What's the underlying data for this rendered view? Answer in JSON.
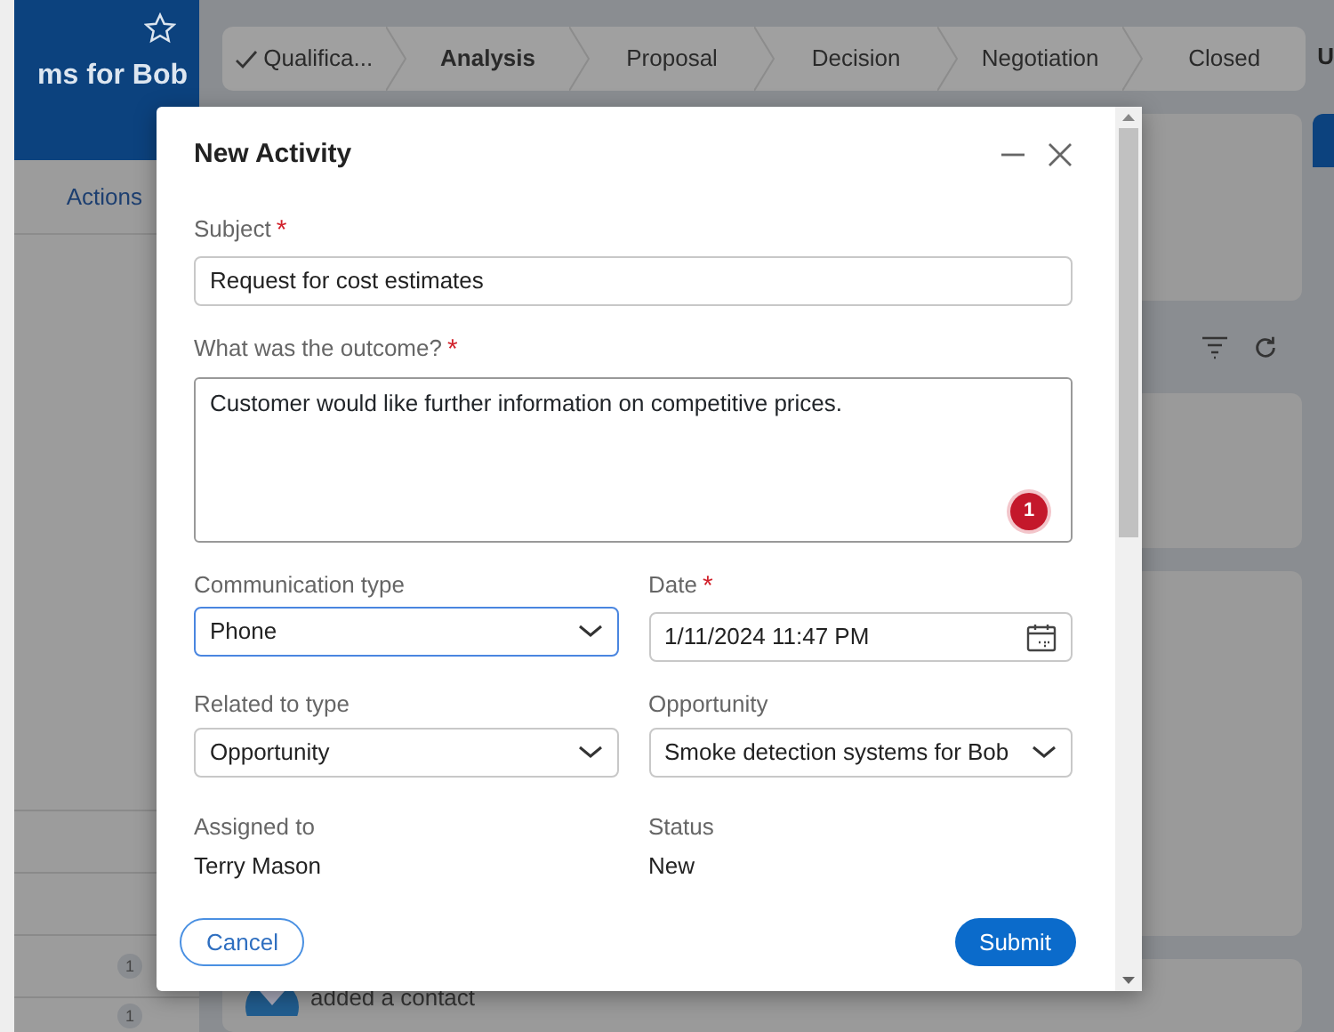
{
  "sidebar": {
    "title": "ms for Bob",
    "actions_label": "Actions",
    "counts": [
      "1",
      "1"
    ]
  },
  "stages": [
    {
      "label": "Qualifica...",
      "completed": true,
      "selected": false
    },
    {
      "label": "Analysis",
      "completed": false,
      "selected": true
    },
    {
      "label": "Proposal",
      "completed": false,
      "selected": false
    },
    {
      "label": "Decision",
      "completed": false,
      "selected": false
    },
    {
      "label": "Negotiation",
      "completed": false,
      "selected": false
    },
    {
      "label": "Closed",
      "completed": false,
      "selected": false
    }
  ],
  "right_edge_label": "U",
  "feed": {
    "entry_text": "added a contact"
  },
  "dialog": {
    "title": "New Activity",
    "fields": [
      {
        "kind": "text",
        "label": "Subject",
        "required_mark": "*",
        "value": "Request for cost estimates",
        "focused": false
      },
      {
        "kind": "textarea",
        "label": "What was the outcome?",
        "required_mark": "*",
        "value": "Customer would like further information on competitive prices.",
        "focused": false,
        "issue_count": "1"
      },
      {
        "kind": "select",
        "label": "Communication type",
        "value": "Phone",
        "focused": true
      },
      {
        "kind": "date",
        "label": "Date",
        "required_mark": "*",
        "value": "1/11/2024 11:47 PM",
        "focused": false
      },
      {
        "kind": "select",
        "label": "Related to type",
        "value": "Opportunity",
        "focused": false
      },
      {
        "kind": "lookup",
        "label": "Opportunity",
        "value": "Smoke detection systems for Bob",
        "focused": false
      },
      {
        "kind": "readonly",
        "label": "Assigned to",
        "value": "Terry Mason"
      },
      {
        "kind": "readonly",
        "label": "Status",
        "value": "New"
      }
    ],
    "cancel_label": "Cancel",
    "submit_label": "Submit"
  }
}
